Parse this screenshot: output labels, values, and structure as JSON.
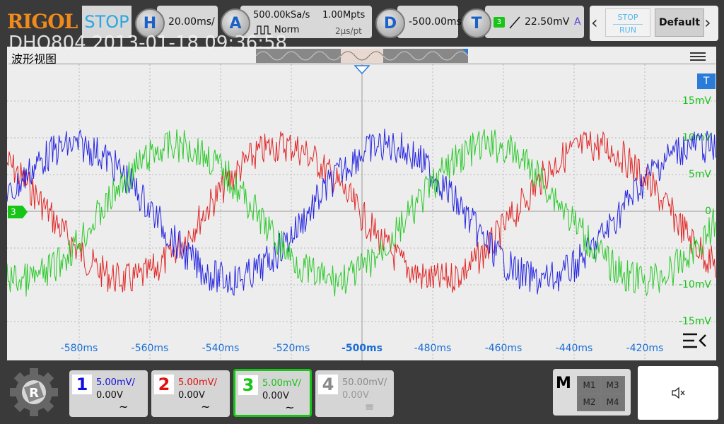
{
  "brand": "RIGOL",
  "run_state": "STOP",
  "overlay_title": "DHO804 2013-01-18 09:36:58",
  "horizontal": {
    "letter": "H",
    "scale": "20.00ms/"
  },
  "acquire": {
    "letter": "A",
    "sample_rate": "500.00kSa/s",
    "memory_depth": "1.00Mpts",
    "mode": "Norm",
    "time_per_pt": "2μs/pt"
  },
  "delay": {
    "letter": "D",
    "value": "-500.00ms"
  },
  "trigger": {
    "letter": "T",
    "source": "3",
    "level": "22.50mV",
    "sweep": "A"
  },
  "stop_run": {
    "stop": "STOP",
    "run": "RUN"
  },
  "default_label": "Default",
  "screen": {
    "title": "波形视图",
    "trigger_marker": "T",
    "channel_marker": "3",
    "y_labels": [
      "15mV",
      "10mV",
      "5mV",
      "0",
      "-10mV",
      "-15mV"
    ],
    "x_labels": [
      "-580ms",
      "-560ms",
      "-540ms",
      "-520ms",
      "-500ms",
      "-480ms",
      "-460ms",
      "-440ms",
      "-420ms"
    ]
  },
  "channels": [
    {
      "num": "1",
      "scale": "5.00mV/",
      "offset": "0.00V",
      "coupling": "~",
      "color": "#1010e0",
      "active": false
    },
    {
      "num": "2",
      "scale": "5.00mV/",
      "offset": "0.00V",
      "coupling": "~",
      "color": "#e01010",
      "active": false
    },
    {
      "num": "3",
      "scale": "5.00mV/",
      "offset": "0.00V",
      "coupling": "~",
      "color": "#16c516",
      "active": true
    },
    {
      "num": "4",
      "scale": "50.00mV/",
      "offset": "0.00V",
      "coupling": "≡",
      "color": "#8a8a8a",
      "active": false
    }
  ],
  "math": {
    "label": "M",
    "items": [
      "M1",
      "M3",
      "M2",
      "M4"
    ]
  },
  "icons": {
    "settings": "gear-icon",
    "speaker": "speaker-mute-icon",
    "menu": "hamburger-icon",
    "collapse": "collapse-arrow-icon",
    "nav_left": "chevron-left-icon",
    "nav_right": "chevron-right-icon"
  },
  "colors": {
    "ch1": "#1010e0",
    "ch2": "#e01010",
    "ch3": "#16c516",
    "accent": "#2aa7e0",
    "brand": "#f08a1c"
  }
}
